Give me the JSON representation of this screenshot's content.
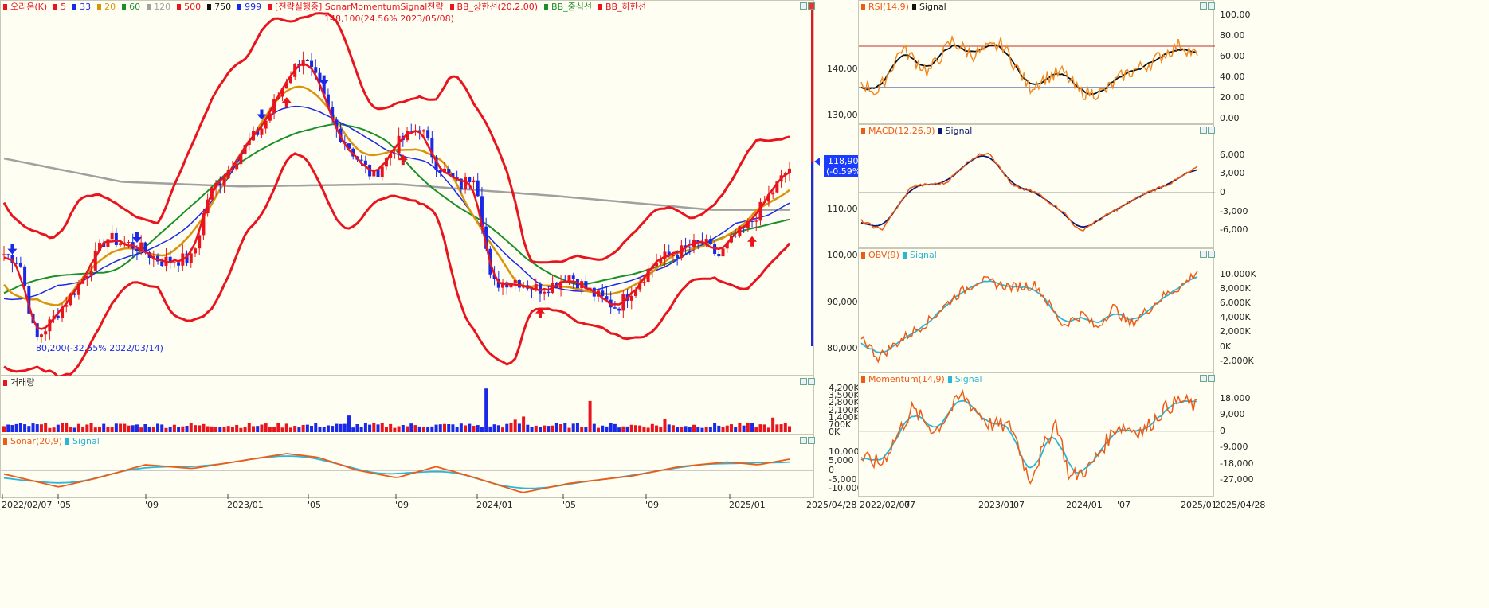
{
  "colors": {
    "red": "#e8141e",
    "blue": "#1a28e8",
    "gold": "#d9950a",
    "green": "#1a8f2a",
    "gray": "#a0a0a0",
    "navy": "#0a1a6e",
    "orange": "#f05a14",
    "cyan": "#2ab6d6",
    "bg": "#fffef3",
    "maroon": "#a00000"
  },
  "main_legend": {
    "items": [
      {
        "text": "오리온(K)",
        "color": "#e8141e"
      },
      {
        "text": "5",
        "color": "#e8141e"
      },
      {
        "text": "33",
        "color": "#1a28e8"
      },
      {
        "text": "20",
        "color": "#d9950a"
      },
      {
        "text": "60",
        "color": "#1a8f2a"
      },
      {
        "text": "120",
        "color": "#a0a0a0"
      },
      {
        "text": "500",
        "color": "#e8141e"
      },
      {
        "text": "750",
        "color": "#111111"
      },
      {
        "text": "999",
        "color": "#1a28e8"
      },
      {
        "text": "[전략실행중] SonarMomentumSignal전략",
        "color": "#e8141e"
      },
      {
        "text": "BB_상한선(20,2.00)",
        "color": "#e8141e"
      },
      {
        "text": "BB_중심선",
        "color": "#1a8f2a"
      },
      {
        "text": "BB_하한선",
        "color": "#e8141e"
      }
    ],
    "high_annotation": "148,100(24.56% 2023/05/08)",
    "low_annotation": "80,200(-32.55% 2022/03/14)",
    "price_tag": [
      "118,900",
      "(-0.59%)"
    ],
    "y_ticks": [
      "140,000",
      "130,000",
      "120,000",
      "110,000",
      "100,000",
      "90,000",
      "80,000"
    ]
  },
  "volume_legend": {
    "label": "거래량",
    "y_ticks": [
      "4,200K",
      "3,500K",
      "2,800K",
      "2,100K",
      "1,400K",
      "700K",
      "0K"
    ]
  },
  "sonar_legend": {
    "label": "Sonar(20,9)",
    "signal": "Signal",
    "y_ticks": [
      "10,000",
      "5,000",
      "0",
      "-5,000",
      "-10,000"
    ]
  },
  "left_x_axis": [
    "2022/02/07",
    "'05",
    "'09",
    "2023/01",
    "'05",
    "'09",
    "2024/01",
    "'05",
    "'09",
    "2025/01",
    "2025/04/28"
  ],
  "rsi": {
    "label": "RSI(14,9)",
    "signal": "Signal",
    "y_ticks": [
      "100.00",
      "80.00",
      "60.00",
      "40.00",
      "20.00",
      "0.00"
    ]
  },
  "macd": {
    "label": "MACD(12,26,9)",
    "signal": "Signal",
    "y_ticks": [
      "6,000",
      "3,000",
      "0",
      "-3,000",
      "-6,000"
    ]
  },
  "obv": {
    "label": "OBV(9)",
    "signal": "Signal",
    "y_ticks": [
      "10,000K",
      "8,000K",
      "6,000K",
      "4,000K",
      "2,000K",
      "0K",
      "-2,000K"
    ]
  },
  "momentum": {
    "label": "Momentum(14,9)",
    "signal": "Signal",
    "y_ticks": [
      "18,000",
      "9,000",
      "0",
      "-9,000",
      "-18,000",
      "-27,000"
    ]
  },
  "right_x_axis": [
    "2022/02/07",
    "'07",
    "2023/01",
    "'07",
    "2024/01",
    "'07",
    "2025/01",
    "2025/04/28"
  ]
}
